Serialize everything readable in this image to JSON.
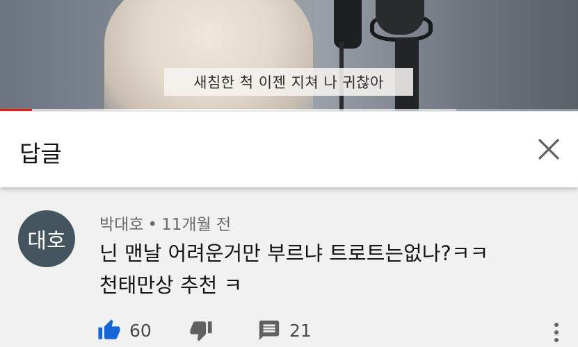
{
  "video": {
    "caption": "새침한 척 이젠 지쳐 나 귀찮아",
    "progress_fraction": 0.055,
    "buffered_fraction": 0.79
  },
  "header": {
    "title": "답글"
  },
  "comment": {
    "avatar_text": "대호",
    "author": "박대호",
    "separator": "•",
    "time": "11개월 전",
    "text_line1": "닌 맨날 어려운거만 부르냐 트로트는없나?ㅋㅋ",
    "text_line2": "천태만상 추천 ㅋ",
    "likes": "60",
    "replies": "21"
  },
  "colors": {
    "progress": "#e62117",
    "like_active": "#1565d8",
    "avatar_bg": "#44555f"
  },
  "icons": [
    "close-icon",
    "thumbs-up-icon",
    "thumbs-down-icon",
    "reply-comment-icon",
    "more-vert-icon"
  ]
}
